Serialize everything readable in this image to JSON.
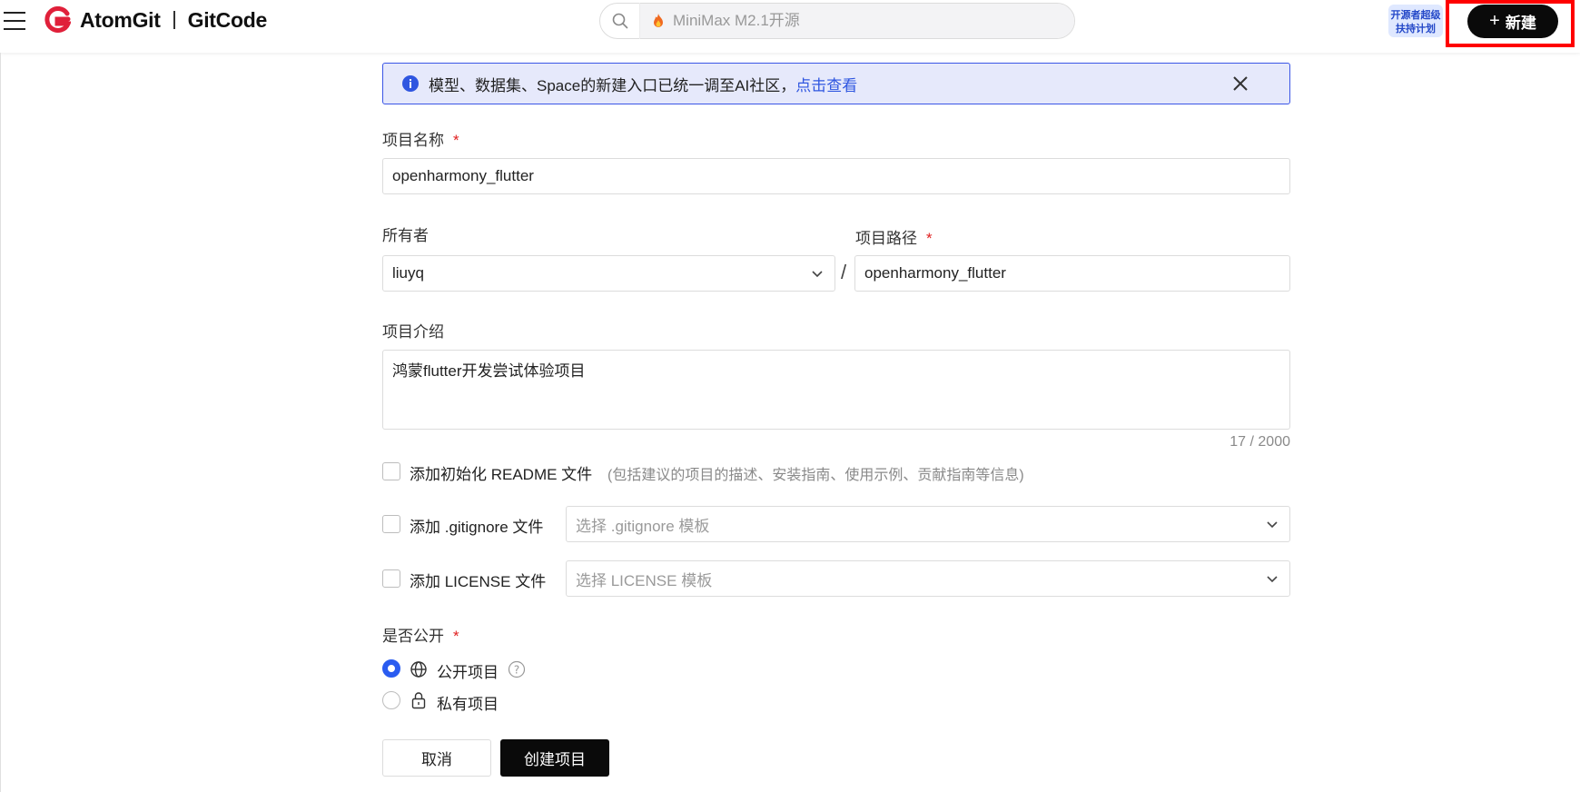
{
  "header": {
    "logo_brand": "AtomGit",
    "logo_product": "GitCode",
    "search_placeholder": "MiniMax M2.1开源",
    "badge_text": "开源者超级扶持计划",
    "new_button_label": "新建"
  },
  "notice": {
    "text": "模型、数据集、Space的新建入口已统一调至AI社区，",
    "link": "点击查看"
  },
  "form": {
    "project_name_label": "项目名称",
    "project_name_value": "openharmony_flutter",
    "owner_label": "所有者",
    "owner_value": "liuyq",
    "path_separator": "/",
    "project_path_label": "项目路径",
    "project_path_value": "openharmony_flutter",
    "description_label": "项目介绍",
    "description_value": "鸿蒙flutter开发尝试体验项目",
    "description_counter": "17 / 2000",
    "readme_label": "添加初始化 README 文件",
    "readme_hint": "(包括建议的项目的描述、安装指南、使用示例、贡献指南等信息)",
    "gitignore_label": "添加 .gitignore 文件",
    "gitignore_placeholder": "选择 .gitignore 模板",
    "license_label": "添加 LICENSE 文件",
    "license_placeholder": "选择 LICENSE 模板",
    "visibility_label": "是否公开",
    "visibility_public": "公开项目",
    "visibility_private": "私有项目",
    "visibility_selected": "public",
    "required_mark": "*",
    "cancel_label": "取消",
    "create_label": "创建项目"
  },
  "colors": {
    "accent": "#2a5cf0",
    "notice_bg": "#e6e9fb",
    "required": "#e02020",
    "primary_button": "#0a0a0a",
    "highlight": "#ff0000"
  }
}
